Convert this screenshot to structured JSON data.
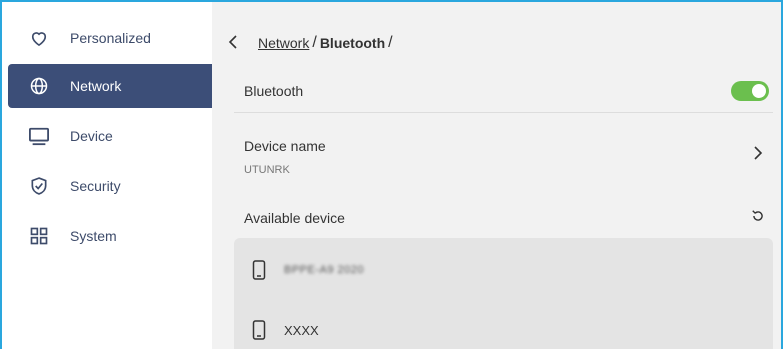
{
  "sidebar": {
    "items": [
      {
        "label": "Personalized",
        "icon": "heart-icon"
      },
      {
        "label": "Network",
        "icon": "globe-icon",
        "active": true
      },
      {
        "label": "Device",
        "icon": "monitor-icon"
      },
      {
        "label": "Security",
        "icon": "shield-check-icon"
      },
      {
        "label": "System",
        "icon": "grid-icon"
      }
    ]
  },
  "breadcrumb": {
    "parent": "Network",
    "separator": "/",
    "current": "Bluetooth",
    "trailing": "/"
  },
  "bluetooth": {
    "label": "Bluetooth",
    "enabled": true
  },
  "device_name": {
    "label": "Device name",
    "value": "UTUNRK"
  },
  "available": {
    "label": "Available device",
    "devices": [
      {
        "name": "BPPE-A9 2020",
        "icon": "phone-icon",
        "blurred": true
      },
      {
        "name": "XXXX",
        "icon": "phone-icon",
        "blurred": false
      }
    ]
  },
  "colors": {
    "accent_nav": "#3c4e78",
    "toggle_on": "#6bbf4e",
    "frame_border": "#2aa7de"
  }
}
